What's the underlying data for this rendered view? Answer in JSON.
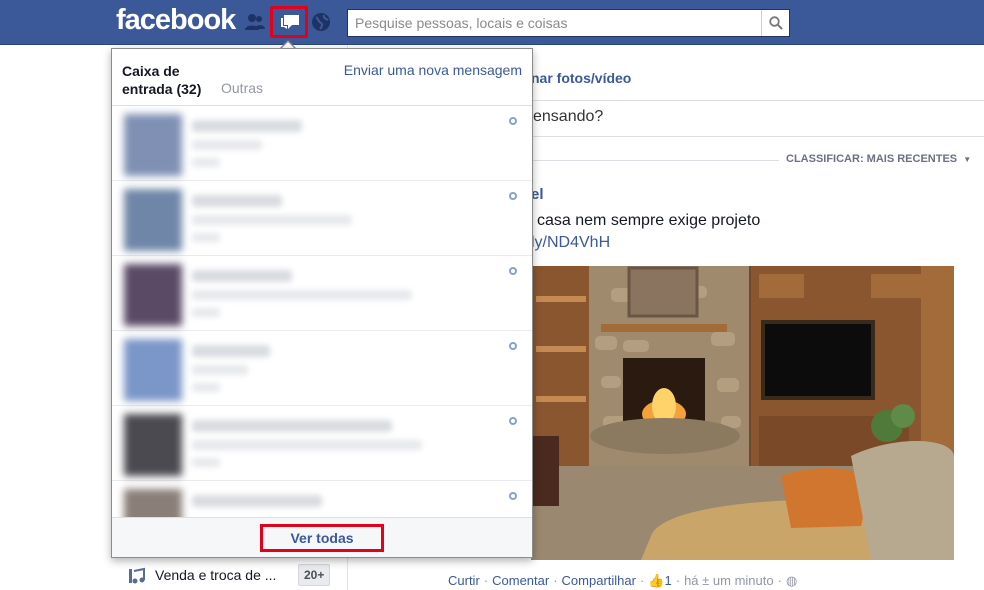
{
  "topbar": {
    "logo": "facebook",
    "search_placeholder": "Pesquise pessoas, locais e coisas"
  },
  "messages_flyout": {
    "inbox_title": "Caixa de entrada (32)",
    "other_tab": "Outras",
    "new_message_link": "Enviar uma nova mensagem",
    "threads_count_visible": 6,
    "see_all": "Ver todas"
  },
  "feed": {
    "composer_tab": "nar fotos/vídeo",
    "composer_placeholder": "ensando?",
    "sort_label": "CLASSIFICAR: MAIS RECENTES",
    "post": {
      "author": "el",
      "text": "casa nem sempre exige projeto",
      "link": "ly/ND4VhH",
      "actions": {
        "like": "Curtir",
        "comment": "Comentar",
        "share": "Compartilhar",
        "like_count": "1",
        "time": "há ± um minuto"
      }
    }
  },
  "sidebar": {
    "item_label": "Venda e troca de ...",
    "item_count": "20+"
  },
  "colors": {
    "brand_blue": "#3b5998",
    "highlight_red": "#e3001b"
  }
}
